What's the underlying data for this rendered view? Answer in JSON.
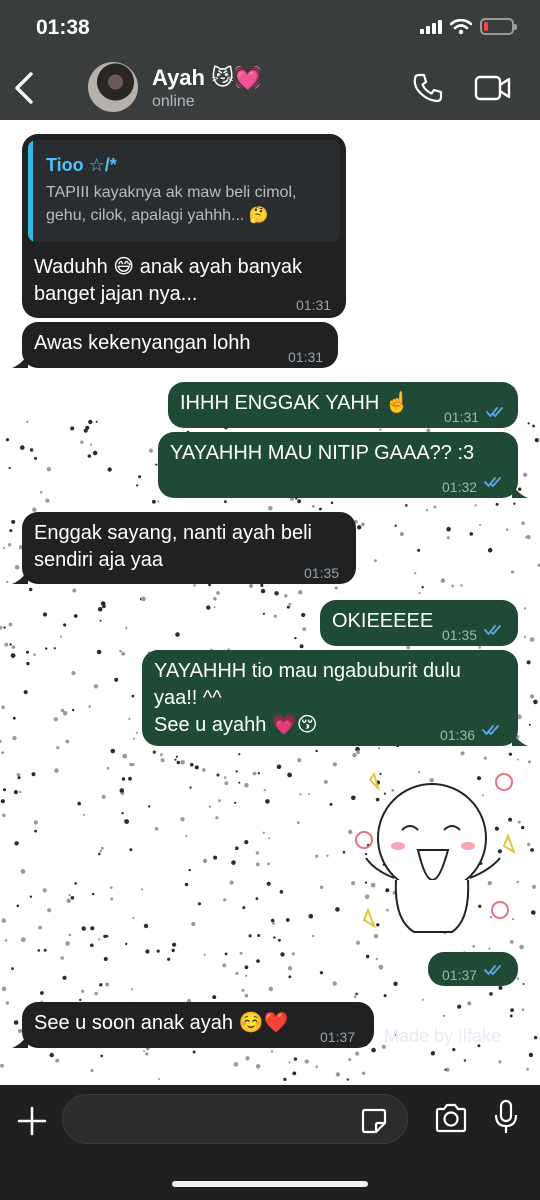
{
  "status_bar": {
    "time": "01:38",
    "battery_level": 0.15,
    "battery_color": "#ff453a"
  },
  "header": {
    "contact_name": "Ayah 😼💓",
    "contact_status": "online",
    "icons": [
      "back-chevron-icon",
      "phone-icon",
      "video-camera-icon"
    ]
  },
  "messages": [
    {
      "direction": "in",
      "quoted": {
        "author": "Tioo ☆/*",
        "text": "TAPIII kayaknya ak maw beli cimol, gehu, cilok, apalagi yahhh... 🤔"
      },
      "text": "Waduhh 😅 anak ayah banyak banget jajan nya...",
      "time": "01:31"
    },
    {
      "direction": "in",
      "text": "Awas kekenyangan lohh",
      "time": "01:31"
    },
    {
      "direction": "out",
      "text": "IHHH ENGGAK YAHH ☝️",
      "time": "01:31",
      "read": true
    },
    {
      "direction": "out",
      "text": "YAYAHHH MAU NITIP GAAA?? :3",
      "time": "01:32",
      "read": true
    },
    {
      "direction": "in",
      "text": "Enggak sayang, nanti ayah beli sendiri aja yaa",
      "time": "01:35"
    },
    {
      "direction": "out",
      "text": "OKIEEEEE",
      "time": "01:35",
      "read": true
    },
    {
      "direction": "out",
      "text": "YAYAHHH tio mau ngabuburit dulu yaa!! ^^\nSee u ayahh 💗😚",
      "time": "01:36",
      "read": true
    },
    {
      "direction": "out",
      "type": "sticker",
      "sticker": "happy-cartoon-sticker",
      "time": "01:37",
      "read": true
    },
    {
      "direction": "in",
      "text": "See u soon anak ayah ☺️❤️",
      "time": "01:37"
    }
  ],
  "wallpaper_watermark": "Made by Ilfake",
  "composer": {
    "placeholder": "",
    "icons": [
      "plus-icon",
      "sticker-icon",
      "camera-icon",
      "microphone-icon"
    ]
  },
  "colors": {
    "header_bg": "#3a3d3e",
    "incoming_bubble": "#1f2123",
    "outgoing_bubble": "#1e4a36",
    "read_ticks": "#5ea8e8",
    "quote_accent": "#35b7e6"
  }
}
